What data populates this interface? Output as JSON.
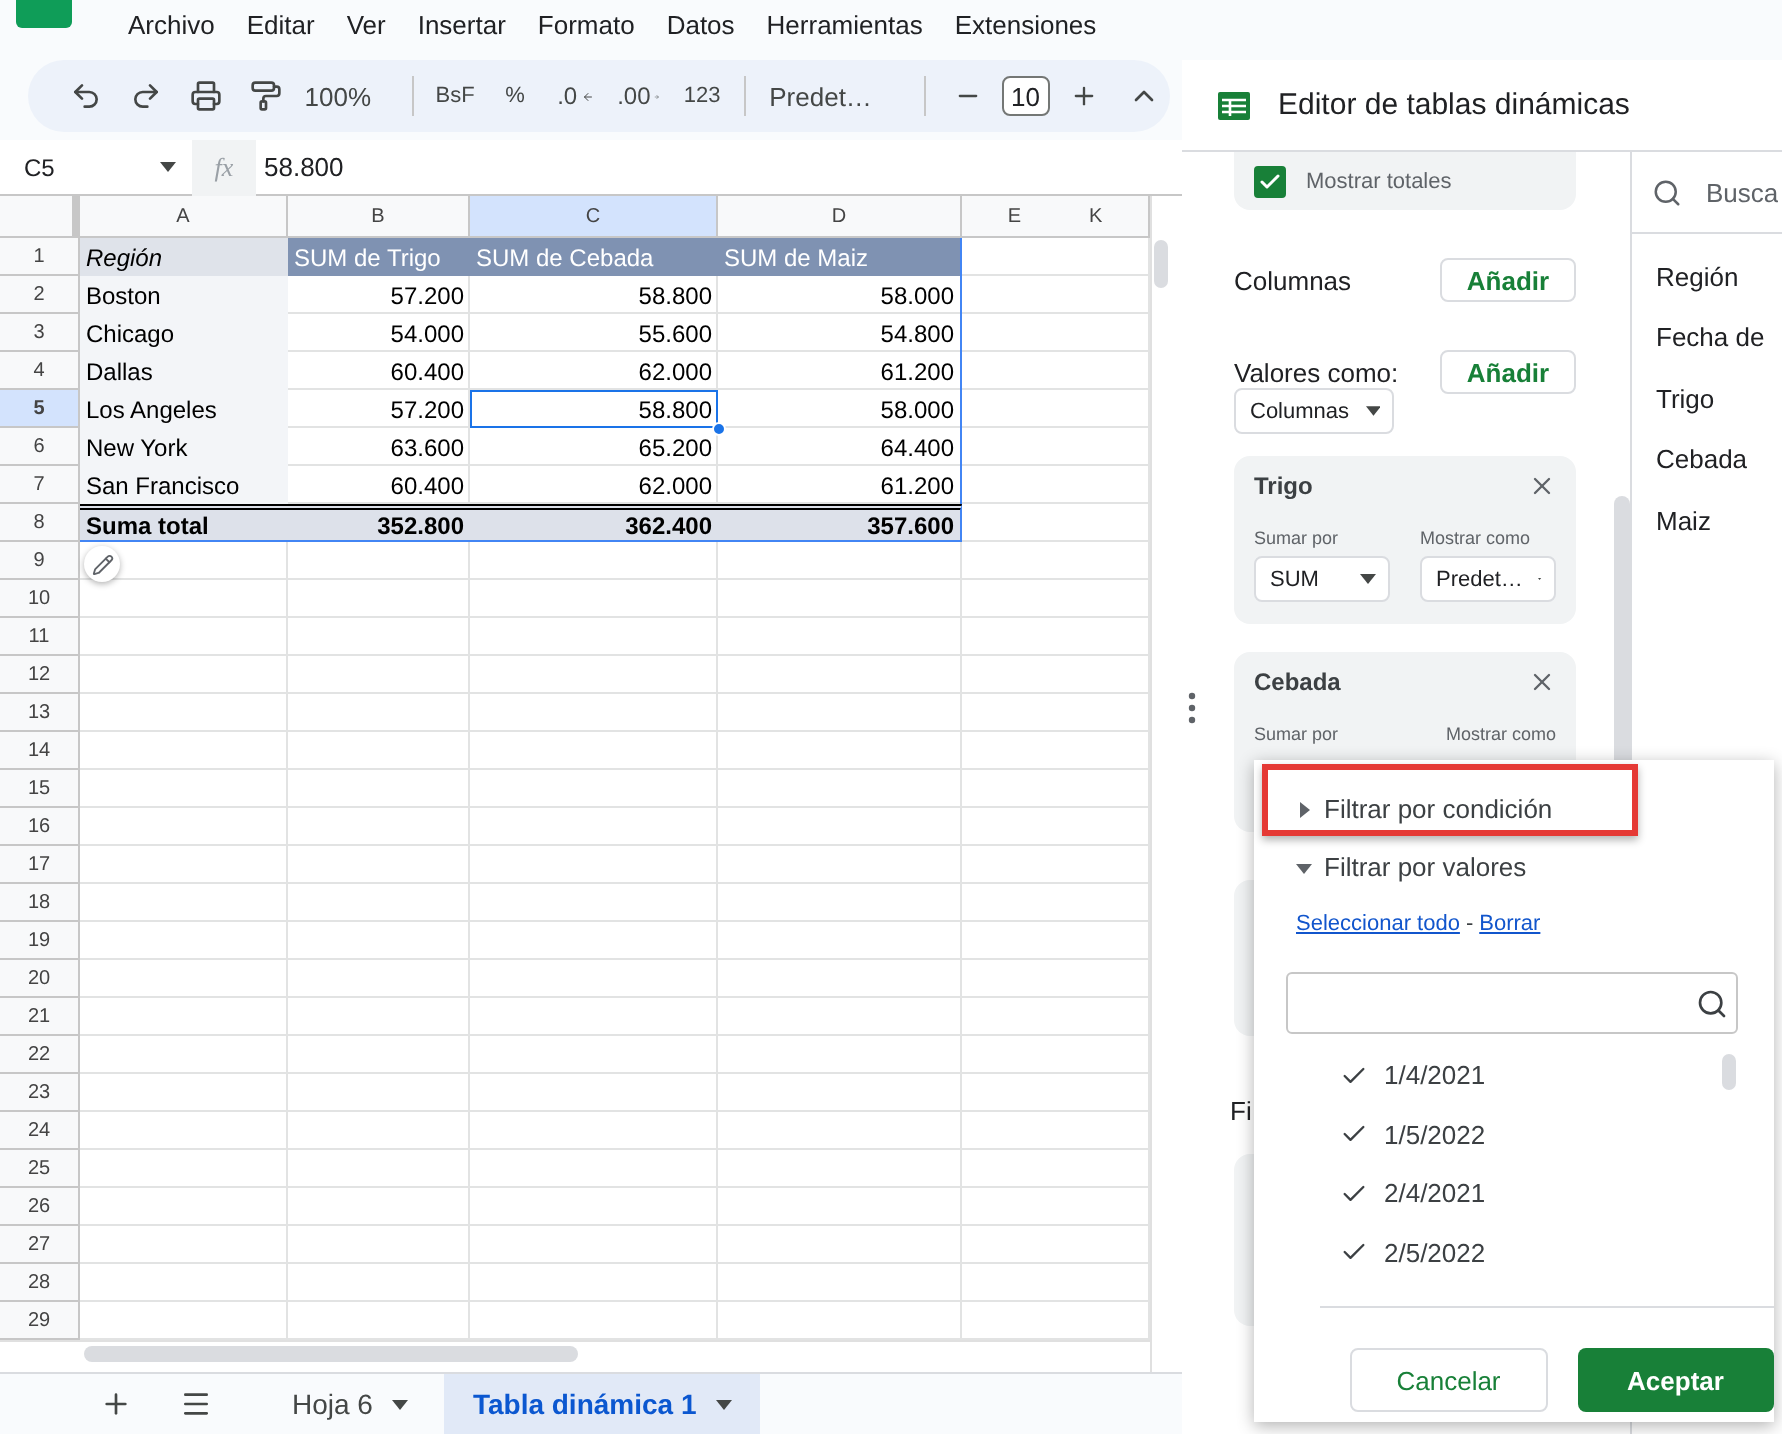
{
  "menu": [
    "Archivo",
    "Editar",
    "Ver",
    "Insertar",
    "Formato",
    "Datos",
    "Herramientas",
    "Extensiones"
  ],
  "toolbar": {
    "zoom": "100%",
    "format_buttons": [
      {
        "kind": "text",
        "label": "BsF"
      },
      {
        "kind": "text",
        "label": "%"
      },
      {
        "kind": "decrease",
        "label": ".0"
      },
      {
        "kind": "increase",
        "label": ".00"
      },
      {
        "kind": "text",
        "label": "123"
      }
    ],
    "font": "Predet…",
    "font_size": "10"
  },
  "formula_bar": {
    "cell": "C5",
    "fx": "fx",
    "value": "58.800"
  },
  "grid": {
    "columns": [
      {
        "label": "A",
        "selected": false
      },
      {
        "label": "B",
        "selected": false
      },
      {
        "label": "C",
        "selected": true
      },
      {
        "label": "D",
        "selected": false
      }
    ],
    "extra_column_labels": [
      "E",
      "K"
    ],
    "header_row": [
      "Región",
      "SUM de Trigo",
      "SUM de Cebada",
      "SUM de Maiz"
    ],
    "data_rows": [
      {
        "region": "Boston",
        "values": [
          {
            "text": "57.200",
            "selected": false
          },
          {
            "text": "58.800",
            "selected": false
          },
          {
            "text": "58.000",
            "selected": false
          }
        ]
      },
      {
        "region": "Chicago",
        "values": [
          {
            "text": "54.000",
            "selected": false
          },
          {
            "text": "55.600",
            "selected": false
          },
          {
            "text": "54.800",
            "selected": false
          }
        ]
      },
      {
        "region": "Dallas",
        "values": [
          {
            "text": "60.400",
            "selected": false
          },
          {
            "text": "62.000",
            "selected": false
          },
          {
            "text": "61.200",
            "selected": false
          }
        ]
      },
      {
        "region": "Los Angeles",
        "values": [
          {
            "text": "57.200",
            "selected": false
          },
          {
            "text": "58.800",
            "selected": true
          },
          {
            "text": "58.000",
            "selected": false
          }
        ]
      },
      {
        "region": "New York",
        "values": [
          {
            "text": "63.600",
            "selected": false
          },
          {
            "text": "65.200",
            "selected": false
          },
          {
            "text": "64.400",
            "selected": false
          }
        ]
      },
      {
        "region": "San Francisco",
        "values": [
          {
            "text": "60.400",
            "selected": false
          },
          {
            "text": "62.000",
            "selected": false
          },
          {
            "text": "61.200",
            "selected": false
          }
        ]
      }
    ],
    "total_row": [
      "Suma total",
      "352.800",
      "362.400",
      "357.600"
    ],
    "row_numbers": [
      {
        "label": "1",
        "selected": false
      },
      {
        "label": "2",
        "selected": false
      },
      {
        "label": "3",
        "selected": false
      },
      {
        "label": "4",
        "selected": false
      },
      {
        "label": "5",
        "selected": true
      },
      {
        "label": "6",
        "selected": false
      },
      {
        "label": "7",
        "selected": false
      },
      {
        "label": "8",
        "selected": false
      },
      {
        "label": "9",
        "selected": false
      },
      {
        "label": "10",
        "selected": false
      },
      {
        "label": "11",
        "selected": false
      },
      {
        "label": "12",
        "selected": false
      },
      {
        "label": "13",
        "selected": false
      },
      {
        "label": "14",
        "selected": false
      },
      {
        "label": "15",
        "selected": false
      },
      {
        "label": "16",
        "selected": false
      },
      {
        "label": "17",
        "selected": false
      },
      {
        "label": "18",
        "selected": false
      },
      {
        "label": "19",
        "selected": false
      },
      {
        "label": "20",
        "selected": false
      },
      {
        "label": "21",
        "selected": false
      },
      {
        "label": "22",
        "selected": false
      },
      {
        "label": "23",
        "selected": false
      },
      {
        "label": "24",
        "selected": false
      },
      {
        "label": "25",
        "selected": false
      },
      {
        "label": "26",
        "selected": false
      },
      {
        "label": "27",
        "selected": false
      },
      {
        "label": "28",
        "selected": false
      },
      {
        "label": "29",
        "selected": false
      }
    ]
  },
  "sheet_tabs": [
    {
      "label": "Hoja 6",
      "selected": false
    },
    {
      "label": "Tabla dinámica 1",
      "selected": true
    }
  ],
  "pivot_editor": {
    "title": "Editor de tablas dinámicas",
    "show_totals": {
      "label": "Mostrar totales",
      "checked": true
    },
    "columns_section": {
      "label": "Columnas",
      "button": "Añadir"
    },
    "values_section": {
      "label": "Valores como:",
      "button": "Añadir",
      "dropdown": "Columnas"
    },
    "value_cards": [
      {
        "title": "Trigo",
        "sum_label": "Sumar por",
        "sum_value": "SUM",
        "show_label": "Mostrar como",
        "show_value": "Predet…"
      },
      {
        "title": "Cebada",
        "sum_label": "Sumar por",
        "show_label": "Mostrar como"
      }
    ],
    "filters_heading": "Fi",
    "fields": {
      "placeholder": "Busca",
      "items": [
        "Región",
        "Fecha de",
        "Trigo",
        "Cebada",
        "Maiz"
      ]
    }
  },
  "filter_popup": {
    "sections": [
      {
        "label": "Filtrar por condición",
        "expanded": false,
        "highlighted": true
      },
      {
        "label": "Filtrar por valores",
        "expanded": true,
        "highlighted": false
      }
    ],
    "links": [
      "Seleccionar todo",
      "Borrar"
    ],
    "link_separator": "-",
    "values": [
      {
        "label": "1/4/2021",
        "checked": true
      },
      {
        "label": "1/5/2022",
        "checked": true
      },
      {
        "label": "2/4/2021",
        "checked": true
      },
      {
        "label": "2/5/2022",
        "checked": true
      }
    ],
    "cancel": "Cancelar",
    "accept": "Aceptar"
  }
}
